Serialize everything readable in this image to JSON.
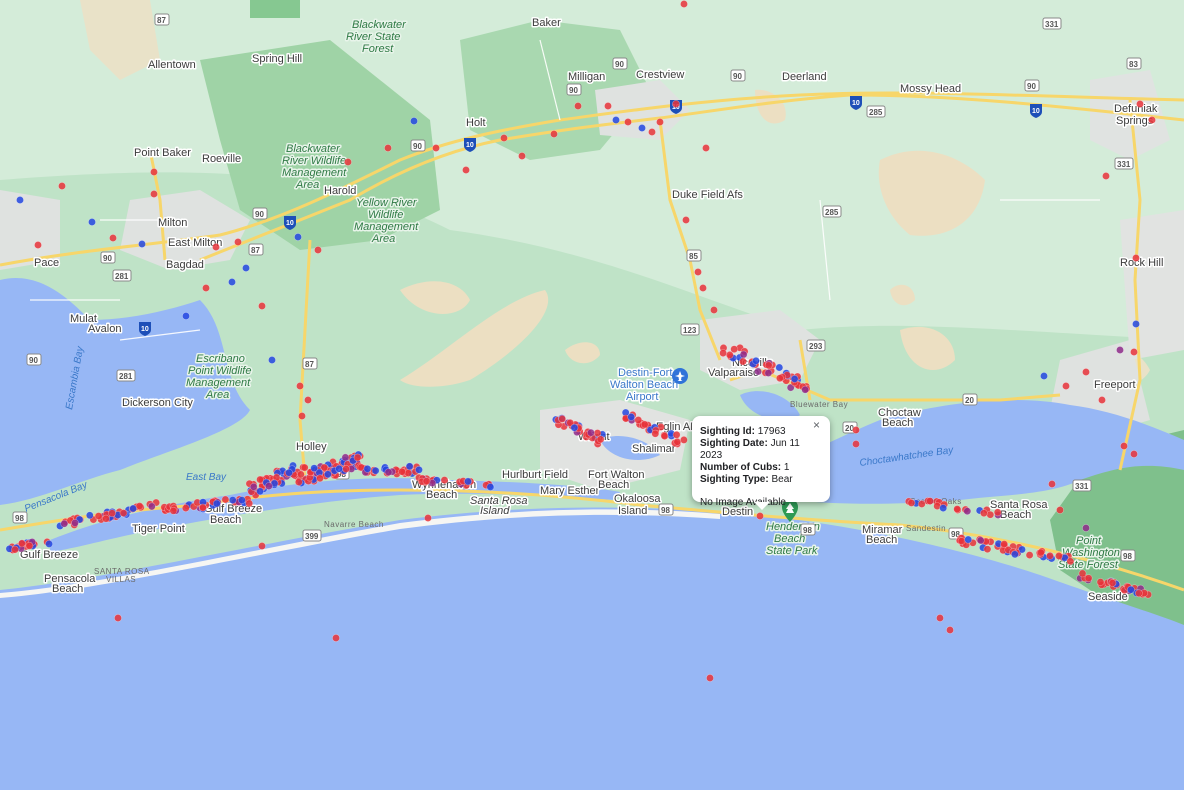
{
  "map": {
    "places": [
      "Baker",
      "Allentown",
      "Spring Hill",
      "Milligan",
      "Crestview",
      "Deerland",
      "Mossy Head",
      "Defuniak Springs",
      "Point Baker",
      "Roeville",
      "Holt",
      "Harold",
      "Milton",
      "East Milton",
      "Bagdad",
      "Pace",
      "Duke Field Afs",
      "Rock Hill",
      "Mulat",
      "Avalon",
      "Dickerson City",
      "Niceville",
      "Valparaiso",
      "Freeport",
      "Choctaw Beach",
      "Holley",
      "Hurlburt Field",
      "Mary Esther",
      "Fort Walton Beach",
      "Wright",
      "Shalimar",
      "Eglin AFB",
      "Okaloosa Island",
      "Destin",
      "Miramar Beach",
      "Santa Rosa Beach",
      "Seaside",
      "Tiger Point",
      "Gulf Breeze",
      "Pensacola Beach",
      "Navarre Beach",
      "Wynnehaven Beach",
      "Santa Rosa Villas",
      "Sandestin",
      "Sacred Oaks",
      "Bluewater Bay"
    ],
    "parks": [
      "Blackwater River State Forest",
      "Blackwater River Wildlife Management Area",
      "Yellow River Wildlife Management Area",
      "Escribano Point Wildlife Management Area",
      "Point Washington State Forest",
      "Henderson Beach State Park",
      "Destin-Fort Walton Beach Airport"
    ],
    "water": [
      "Escambia Bay",
      "East Bay",
      "Pensacola Bay",
      "Choctawhatchee Bay",
      "Santa Rosa Island"
    ],
    "roads": [
      "87",
      "90",
      "10",
      "85",
      "285",
      "331",
      "83",
      "123",
      "293",
      "98",
      "20",
      "399",
      "281",
      "191"
    ],
    "colors": {
      "red": "#e8333a",
      "blue": "#2346e0",
      "purple": "#8e2a8a",
      "sea": "#97b7f5",
      "land": "#bfe3c7"
    }
  },
  "info": {
    "id_label": "Sighting Id:",
    "id_value": "17963",
    "date_label": "Sighting Date:",
    "date_value": "Jun 11 2023",
    "cubs_label": "Number of Cubs:",
    "cubs_value": "1",
    "type_label": "Sighting Type:",
    "type_value": "Bear",
    "note": "No Image Available",
    "close": "×"
  }
}
